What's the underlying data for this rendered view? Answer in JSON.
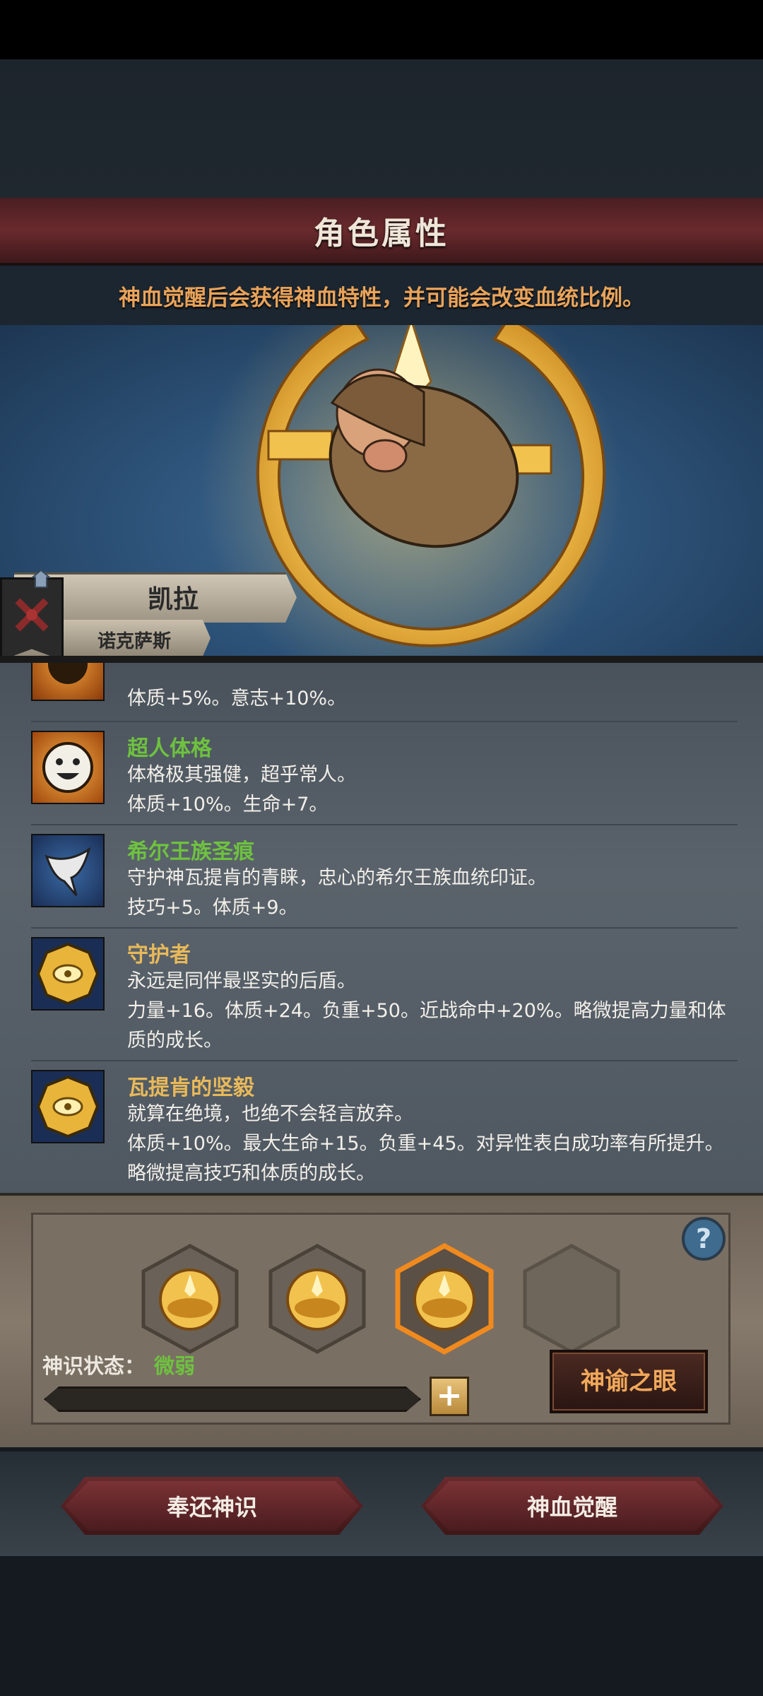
{
  "header": {
    "title": "角色属性"
  },
  "notice": {
    "text": "神血觉醒后会获得神血特性，并可能会改变血统比例。"
  },
  "character": {
    "name": "凯拉",
    "origin": "诺克萨斯"
  },
  "traits": [
    {
      "title": "",
      "desc": "体质+5%。意志+10%。",
      "title_color": "#6ec23f"
    },
    {
      "title": "超人体格",
      "line1": "体格极其强健，超乎常人。",
      "line2": "体质+10%。生命+7。",
      "title_color": "#6ec23f"
    },
    {
      "title": "希尔王族圣痕",
      "line1": "守护神瓦提肯的青睐，忠心的希尔王族血统印证。",
      "line2": "技巧+5。体质+9。",
      "title_color": "#6ec23f"
    },
    {
      "title": "守护者",
      "line1": "永远是同伴最坚实的后盾。",
      "line2": "力量+16。体质+24。负重+50。近战命中+20%。略微提高力量和体",
      "line3": "质的成长。",
      "title_color": "#e8b95a"
    },
    {
      "title": "瓦提肯的坚毅",
      "line1": "就算在绝境，也绝不会轻言放弃。",
      "line2": "体质+10%。最大生命+15。负重+45。对异性表白成功率有所提升。",
      "line3": "略微提高技巧和体质的成长。",
      "title_color": "#e8b95a"
    }
  ],
  "awaken": {
    "status_label": "神识状态：",
    "status_value": "微弱",
    "plus_label": "+",
    "help_label": "?",
    "eye_button": "神谕之眼",
    "progress": 0.0
  },
  "buttons": {
    "return": "奉还神识",
    "awaken": "神血觉醒"
  }
}
